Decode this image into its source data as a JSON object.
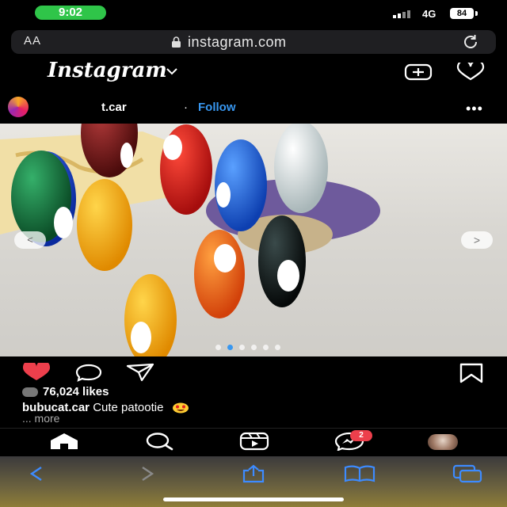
{
  "status_bar": {
    "time": "9:02",
    "network": "4G",
    "battery": "84"
  },
  "browser": {
    "text_size_label": "AA",
    "url": "instagram.com"
  },
  "app": {
    "logo_text": "Instagram"
  },
  "post": {
    "username": "bubucat.car",
    "header_username_visible": "t.car",
    "separator": "·",
    "follow_label": "Follow",
    "more_options": "•••",
    "carousel": {
      "dots": 6,
      "active_index": 1
    },
    "likes": "76,024 likes",
    "caption_user": "bubucat.car",
    "caption_text": "Cute patootie",
    "more_label": "... more"
  },
  "nav": {
    "messenger_badge": "2"
  },
  "icons": [
    "lock-icon",
    "reload-icon",
    "chevron-down-icon",
    "new-post-icon",
    "heart-icon",
    "more-icon",
    "like-icon",
    "comment-icon",
    "share-icon",
    "save-icon",
    "home-icon",
    "search-icon",
    "reels-icon",
    "messenger-icon",
    "back-icon",
    "forward-icon",
    "share-sheet-icon",
    "bookmarks-icon",
    "tabs-icon"
  ],
  "colors": {
    "accent": "#3897f0",
    "like": "#ed3f4c",
    "status_pill": "#2fc549",
    "badge": "#ed3f4c"
  }
}
